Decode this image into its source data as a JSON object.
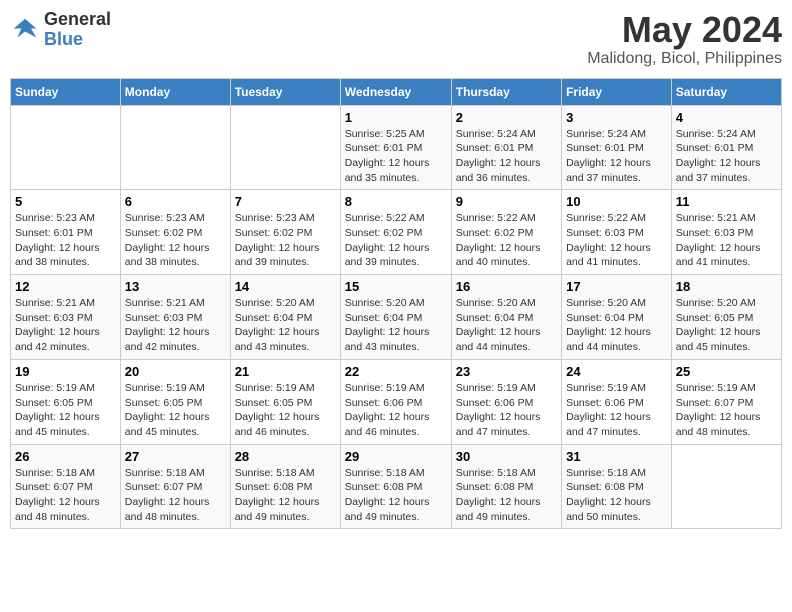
{
  "header": {
    "logo_line1": "General",
    "logo_line2": "Blue",
    "month": "May 2024",
    "location": "Malidong, Bicol, Philippines"
  },
  "columns": [
    "Sunday",
    "Monday",
    "Tuesday",
    "Wednesday",
    "Thursday",
    "Friday",
    "Saturday"
  ],
  "weeks": [
    [
      {
        "day": "",
        "detail": ""
      },
      {
        "day": "",
        "detail": ""
      },
      {
        "day": "",
        "detail": ""
      },
      {
        "day": "1",
        "detail": "Sunrise: 5:25 AM\nSunset: 6:01 PM\nDaylight: 12 hours\nand 35 minutes."
      },
      {
        "day": "2",
        "detail": "Sunrise: 5:24 AM\nSunset: 6:01 PM\nDaylight: 12 hours\nand 36 minutes."
      },
      {
        "day": "3",
        "detail": "Sunrise: 5:24 AM\nSunset: 6:01 PM\nDaylight: 12 hours\nand 37 minutes."
      },
      {
        "day": "4",
        "detail": "Sunrise: 5:24 AM\nSunset: 6:01 PM\nDaylight: 12 hours\nand 37 minutes."
      }
    ],
    [
      {
        "day": "5",
        "detail": "Sunrise: 5:23 AM\nSunset: 6:01 PM\nDaylight: 12 hours\nand 38 minutes."
      },
      {
        "day": "6",
        "detail": "Sunrise: 5:23 AM\nSunset: 6:02 PM\nDaylight: 12 hours\nand 38 minutes."
      },
      {
        "day": "7",
        "detail": "Sunrise: 5:23 AM\nSunset: 6:02 PM\nDaylight: 12 hours\nand 39 minutes."
      },
      {
        "day": "8",
        "detail": "Sunrise: 5:22 AM\nSunset: 6:02 PM\nDaylight: 12 hours\nand 39 minutes."
      },
      {
        "day": "9",
        "detail": "Sunrise: 5:22 AM\nSunset: 6:02 PM\nDaylight: 12 hours\nand 40 minutes."
      },
      {
        "day": "10",
        "detail": "Sunrise: 5:22 AM\nSunset: 6:03 PM\nDaylight: 12 hours\nand 41 minutes."
      },
      {
        "day": "11",
        "detail": "Sunrise: 5:21 AM\nSunset: 6:03 PM\nDaylight: 12 hours\nand 41 minutes."
      }
    ],
    [
      {
        "day": "12",
        "detail": "Sunrise: 5:21 AM\nSunset: 6:03 PM\nDaylight: 12 hours\nand 42 minutes."
      },
      {
        "day": "13",
        "detail": "Sunrise: 5:21 AM\nSunset: 6:03 PM\nDaylight: 12 hours\nand 42 minutes."
      },
      {
        "day": "14",
        "detail": "Sunrise: 5:20 AM\nSunset: 6:04 PM\nDaylight: 12 hours\nand 43 minutes."
      },
      {
        "day": "15",
        "detail": "Sunrise: 5:20 AM\nSunset: 6:04 PM\nDaylight: 12 hours\nand 43 minutes."
      },
      {
        "day": "16",
        "detail": "Sunrise: 5:20 AM\nSunset: 6:04 PM\nDaylight: 12 hours\nand 44 minutes."
      },
      {
        "day": "17",
        "detail": "Sunrise: 5:20 AM\nSunset: 6:04 PM\nDaylight: 12 hours\nand 44 minutes."
      },
      {
        "day": "18",
        "detail": "Sunrise: 5:20 AM\nSunset: 6:05 PM\nDaylight: 12 hours\nand 45 minutes."
      }
    ],
    [
      {
        "day": "19",
        "detail": "Sunrise: 5:19 AM\nSunset: 6:05 PM\nDaylight: 12 hours\nand 45 minutes."
      },
      {
        "day": "20",
        "detail": "Sunrise: 5:19 AM\nSunset: 6:05 PM\nDaylight: 12 hours\nand 45 minutes."
      },
      {
        "day": "21",
        "detail": "Sunrise: 5:19 AM\nSunset: 6:05 PM\nDaylight: 12 hours\nand 46 minutes."
      },
      {
        "day": "22",
        "detail": "Sunrise: 5:19 AM\nSunset: 6:06 PM\nDaylight: 12 hours\nand 46 minutes."
      },
      {
        "day": "23",
        "detail": "Sunrise: 5:19 AM\nSunset: 6:06 PM\nDaylight: 12 hours\nand 47 minutes."
      },
      {
        "day": "24",
        "detail": "Sunrise: 5:19 AM\nSunset: 6:06 PM\nDaylight: 12 hours\nand 47 minutes."
      },
      {
        "day": "25",
        "detail": "Sunrise: 5:19 AM\nSunset: 6:07 PM\nDaylight: 12 hours\nand 48 minutes."
      }
    ],
    [
      {
        "day": "26",
        "detail": "Sunrise: 5:18 AM\nSunset: 6:07 PM\nDaylight: 12 hours\nand 48 minutes."
      },
      {
        "day": "27",
        "detail": "Sunrise: 5:18 AM\nSunset: 6:07 PM\nDaylight: 12 hours\nand 48 minutes."
      },
      {
        "day": "28",
        "detail": "Sunrise: 5:18 AM\nSunset: 6:08 PM\nDaylight: 12 hours\nand 49 minutes."
      },
      {
        "day": "29",
        "detail": "Sunrise: 5:18 AM\nSunset: 6:08 PM\nDaylight: 12 hours\nand 49 minutes."
      },
      {
        "day": "30",
        "detail": "Sunrise: 5:18 AM\nSunset: 6:08 PM\nDaylight: 12 hours\nand 49 minutes."
      },
      {
        "day": "31",
        "detail": "Sunrise: 5:18 AM\nSunset: 6:08 PM\nDaylight: 12 hours\nand 50 minutes."
      },
      {
        "day": "",
        "detail": ""
      }
    ]
  ]
}
